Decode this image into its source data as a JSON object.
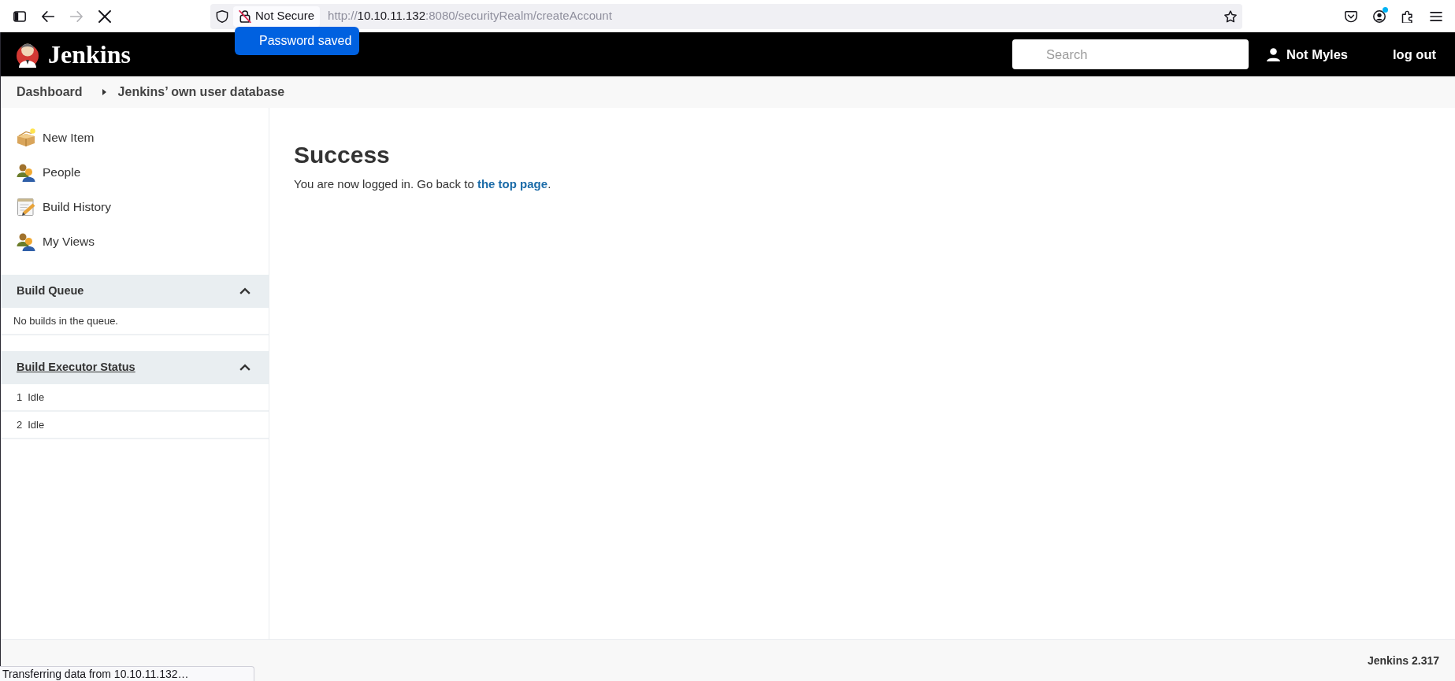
{
  "browser_toolbar": {
    "nav_buttons": [
      {
        "kind": "sidebar",
        "disabled": false
      },
      {
        "kind": "back",
        "disabled": false
      },
      {
        "kind": "forward",
        "disabled": true
      },
      {
        "kind": "stop",
        "disabled": false
      }
    ],
    "address_bar": {
      "security_label": "Not Secure",
      "url": [
        {
          "text": "http://",
          "emphasis": false
        },
        {
          "text": "10.10.11.132",
          "emphasis": true
        },
        {
          "text": ":8080/securityRealm/createAccount",
          "emphasis": false
        }
      ]
    },
    "right_buttons": [
      {
        "kind": "pocket",
        "notification": false
      },
      {
        "kind": "account",
        "notification": true
      },
      {
        "kind": "extensions",
        "notification": false
      },
      {
        "kind": "menu",
        "notification": false
      }
    ]
  },
  "password_popup": {
    "text": "Password saved"
  },
  "header": {
    "logo_text": "Jenkins",
    "search": {
      "placeholder": "Search"
    },
    "user": "Not Myles",
    "logout": "log out"
  },
  "breadcrumbs": [
    {
      "label": "Dashboard"
    },
    {
      "label": "Jenkins’ own user database"
    }
  ],
  "sidebar": {
    "tasks": [
      {
        "label": "New Item",
        "kind": "new-item"
      },
      {
        "label": "People",
        "kind": "people"
      },
      {
        "label": "Build History",
        "kind": "history"
      },
      {
        "label": "My Views",
        "kind": "people"
      }
    ],
    "panes": [
      {
        "title": "Build Queue",
        "link": false,
        "expanded": true,
        "rows": [
          {
            "text": "No builds in the queue."
          }
        ]
      },
      {
        "title": "Build Executor Status",
        "link": true,
        "expanded": true,
        "rows": [
          {
            "number": "1",
            "status": "Idle"
          },
          {
            "number": "2",
            "status": "Idle"
          }
        ]
      }
    ]
  },
  "main": {
    "title": "Success",
    "message": {
      "before": "You are now logged in. Go back to ",
      "link": "the top page",
      "after": "."
    }
  },
  "footer": {
    "version": "Jenkins 2.317"
  },
  "status_bar": {
    "text": "Transferring data from 10.10.11.132…"
  }
}
